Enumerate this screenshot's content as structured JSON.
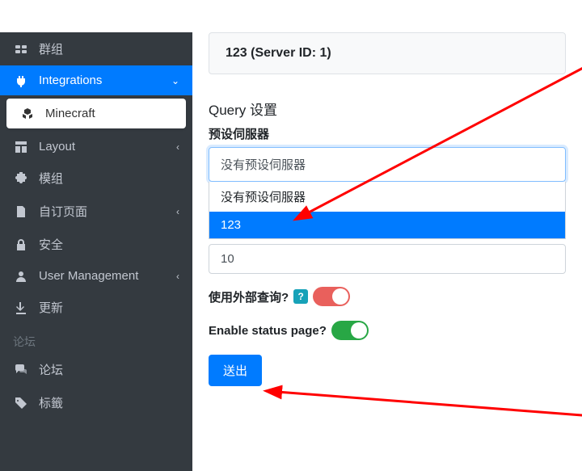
{
  "sidebar": {
    "items": [
      {
        "label": "群组"
      },
      {
        "label": "Integrations"
      },
      {
        "label": "Minecraft"
      },
      {
        "label": "Layout"
      },
      {
        "label": "模组"
      },
      {
        "label": "自订页面"
      },
      {
        "label": "安全"
      },
      {
        "label": "User Management"
      },
      {
        "label": "更新"
      }
    ],
    "section": "论坛",
    "forum_items": [
      {
        "label": "论坛"
      },
      {
        "label": "标籤"
      }
    ]
  },
  "main": {
    "banner": "123 (Server ID: 1)",
    "section_title": "Query 设置",
    "field_label": "预设伺服器",
    "select_value": "没有预设伺服器",
    "options": [
      {
        "label": "没有预设伺服器"
      },
      {
        "label": "123"
      }
    ],
    "input_value": "10",
    "toggle1_label": "使用外部查询?",
    "toggle2_label": "Enable status page?",
    "submit_label": "送出"
  }
}
